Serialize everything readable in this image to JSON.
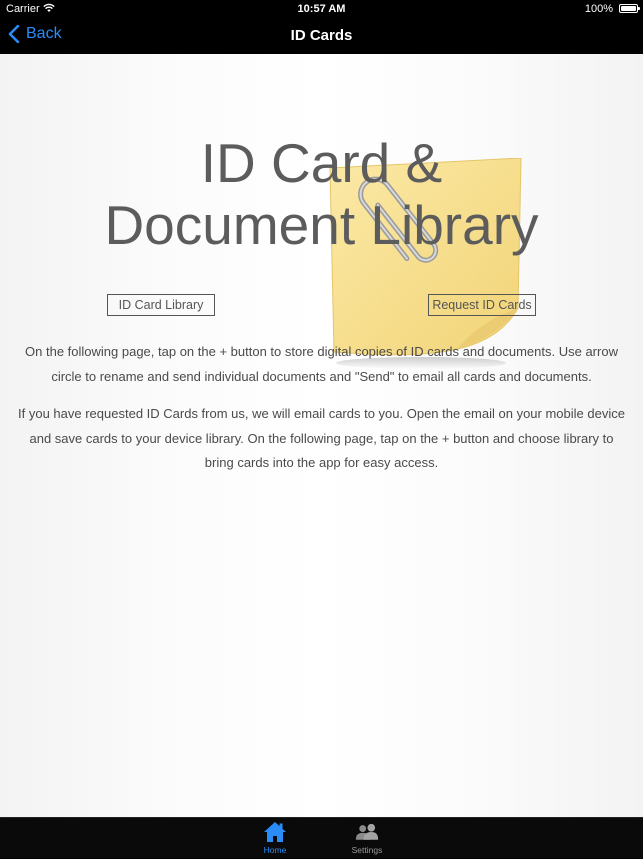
{
  "status_bar": {
    "carrier": "Carrier",
    "time": "10:57 AM",
    "battery": "100%"
  },
  "nav": {
    "back_label": "Back",
    "title": "ID Cards"
  },
  "hero": {
    "title_line1": "ID Card &",
    "title_line2": "Document Library"
  },
  "buttons": {
    "library_label": "ID Card Library",
    "request_label": "Request ID Cards"
  },
  "instructions": {
    "p1_line1": "On the following page, tap on the + button to store digital copies of ID cards and documents.  Use arrow",
    "p1_line2": "circle to rename and send individual documents and \"Send\" to email all cards and documents.",
    "p2_line1": "If you have requested ID Cards from us, we will email cards to you.  Open the email on your mobile device",
    "p2_line2": "and save cards to your device library.  On the following page, tap on the + button and choose library to",
    "p2_line3": "bring cards into the app for easy access."
  },
  "tabs": [
    {
      "label": "Home",
      "icon": "home-icon",
      "active": true
    },
    {
      "label": "Settings",
      "icon": "users-icon",
      "active": false
    }
  ],
  "colors": {
    "accent": "#2a8cf7",
    "text": "#4a4a4a",
    "note_yellow": "#f5dc8a"
  }
}
